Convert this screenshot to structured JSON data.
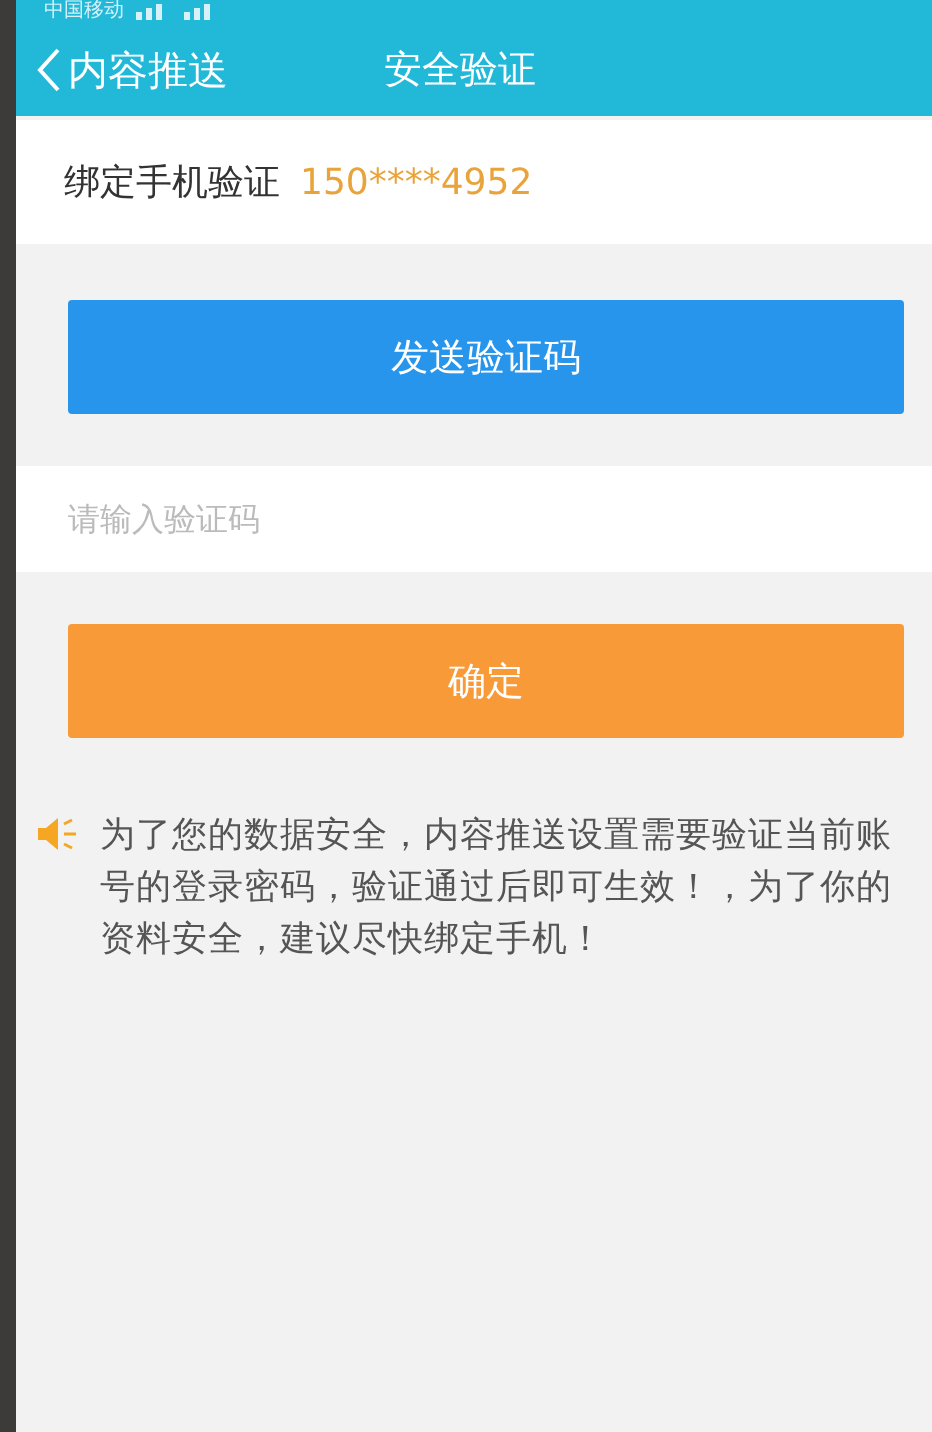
{
  "status_bar": {
    "carrier": "中国移动"
  },
  "nav": {
    "back": "内容推送",
    "title": "安全验证"
  },
  "phone_row": {
    "label": "绑定手机验证",
    "phone": "150****4952"
  },
  "send_button": "发送验证码",
  "code_field": {
    "placeholder": "请输入验证码"
  },
  "confirm_button": "确定",
  "notice": "为了您的数据安全，内容推送设置需要验证当前账号的登录密码，验证通过后即可生效！，为了你的资料安全，建议尽快绑定手机！"
}
